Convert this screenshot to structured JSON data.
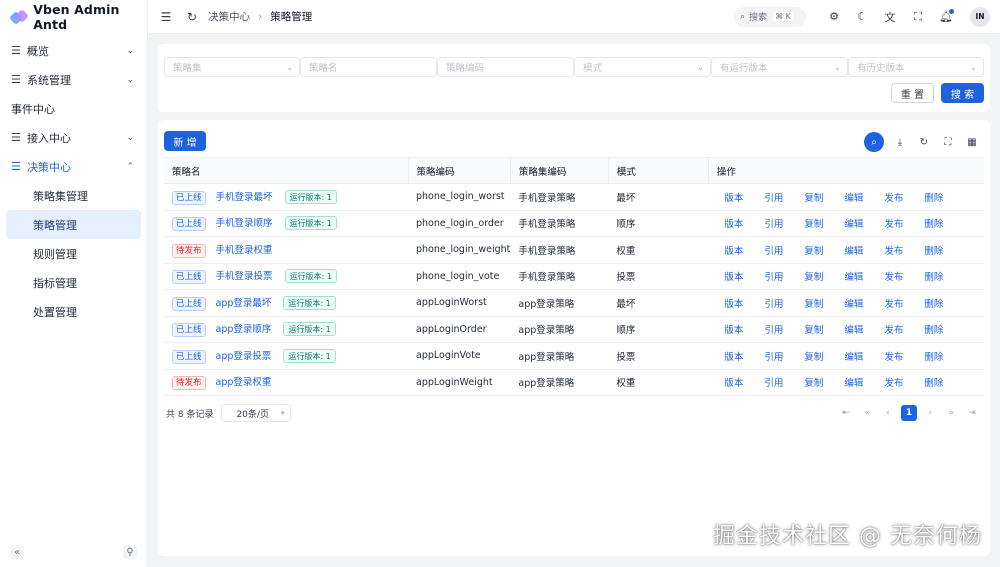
{
  "app": {
    "title": "Vben Admin Antd"
  },
  "sidebar": {
    "items": [
      {
        "label": "概览",
        "icon": "menu-icon",
        "chevron": "⌄"
      },
      {
        "label": "系统管理",
        "icon": "menu-icon",
        "chevron": "⌄"
      },
      {
        "label": "事件中心"
      },
      {
        "label": "接入中心",
        "icon": "menu-icon",
        "chevron": "⌄"
      },
      {
        "label": "决策中心",
        "icon": "menu-icon",
        "chevron": "⌃",
        "open": true
      }
    ],
    "sub_items": [
      {
        "label": "策略集管理"
      },
      {
        "label": "策略管理",
        "active": true
      },
      {
        "label": "规则管理"
      },
      {
        "label": "指标管理"
      },
      {
        "label": "处置管理"
      }
    ],
    "collapse_icon": "«",
    "pin_icon": "⚲"
  },
  "header": {
    "breadcrumb": [
      "决策中心",
      "策略管理"
    ],
    "search_label": "搜索",
    "search_shortcut": "⌘ K",
    "avatar": "IN"
  },
  "filters": {
    "fields": [
      {
        "placeholder": "策略集",
        "select": true
      },
      {
        "placeholder": "策略名",
        "select": false
      },
      {
        "placeholder": "策略编码",
        "select": false
      },
      {
        "placeholder": "模式",
        "select": true
      },
      {
        "placeholder": "有运行版本",
        "select": true
      },
      {
        "placeholder": "有历史版本",
        "select": true
      }
    ],
    "reset_label": "重 置",
    "search_label": "搜 索"
  },
  "toolbar": {
    "add_label": "新 增"
  },
  "table": {
    "columns": [
      "策略名",
      "策略编码",
      "策略集编码",
      "模式",
      "操作"
    ],
    "actions": [
      "版本",
      "引用",
      "复制",
      "编辑",
      "发布",
      "删除"
    ],
    "rows": [
      {
        "status": "已上线",
        "status_type": "on",
        "name": "手机登录最坏",
        "version": "运行版本: 1",
        "code": "phone_login_worst",
        "set": "手机登录策略",
        "mode": "最坏"
      },
      {
        "status": "已上线",
        "status_type": "on",
        "name": "手机登录顺序",
        "version": "运行版本: 1",
        "code": "phone_login_order",
        "set": "手机登录策略",
        "mode": "顺序"
      },
      {
        "status": "待发布",
        "status_type": "pending",
        "name": "手机登录权重",
        "version": "",
        "code": "phone_login_weight",
        "set": "手机登录策略",
        "mode": "权重"
      },
      {
        "status": "已上线",
        "status_type": "on",
        "name": "手机登录投票",
        "version": "运行版本: 1",
        "code": "phone_login_vote",
        "set": "手机登录策略",
        "mode": "投票"
      },
      {
        "status": "已上线",
        "status_type": "on",
        "name": "app登录最坏",
        "version": "运行版本: 1",
        "code": "appLoginWorst",
        "set": "app登录策略",
        "mode": "最坏"
      },
      {
        "status": "已上线",
        "status_type": "on",
        "name": "app登录顺序",
        "version": "运行版本: 1",
        "code": "appLoginOrder",
        "set": "app登录策略",
        "mode": "顺序"
      },
      {
        "status": "已上线",
        "status_type": "on",
        "name": "app登录投票",
        "version": "运行版本: 1",
        "code": "appLoginVote",
        "set": "app登录策略",
        "mode": "投票"
      },
      {
        "status": "待发布",
        "status_type": "pending",
        "name": "app登录权重",
        "version": "",
        "code": "appLoginWeight",
        "set": "app登录策略",
        "mode": "权重"
      }
    ]
  },
  "pagination": {
    "total_label": "共 8 条记录",
    "page_size": "20条/页",
    "current": "1",
    "first": "⇤",
    "prev_jump": "«",
    "prev": "‹",
    "next": "›",
    "next_jump": "»",
    "last": "⇥"
  },
  "watermark": "掘金技术社区 @ 无奈何杨",
  "colors": {
    "primary": "#1d63e0",
    "pending": "#dc2626",
    "version_tag": "#0f766e"
  }
}
